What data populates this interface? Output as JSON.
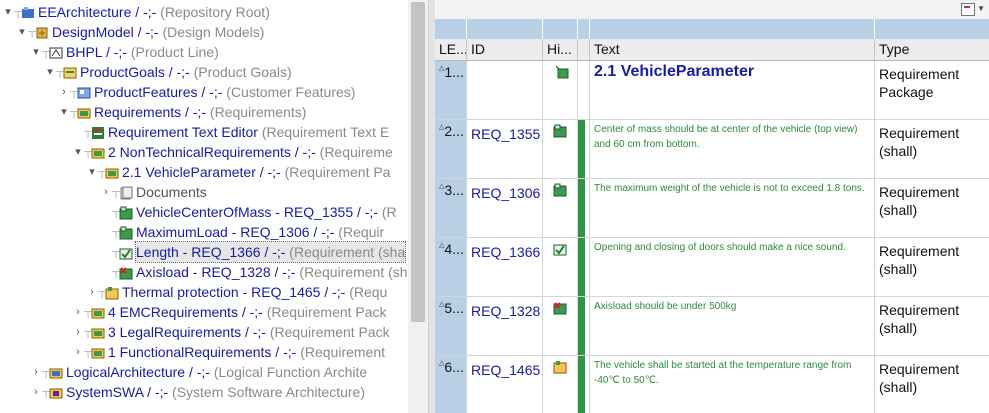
{
  "tree": {
    "rows": [
      {
        "name": "EEArchitecture / -;-",
        "meta": " (Repository Root)",
        "icon": "repository-root-icon",
        "twist": "▾"
      },
      {
        "name": "DesignModel / -;-",
        "meta": " (Design Models)",
        "icon": "design-model-icon",
        "twist": "▾"
      },
      {
        "name": "BHPL / -;-",
        "meta": " (Product Line)",
        "icon": "product-line-icon",
        "twist": "▾"
      },
      {
        "name": "ProductGoals / -;-",
        "meta": " (Product Goals)",
        "icon": "product-goals-icon",
        "twist": "▾"
      },
      {
        "name": "ProductFeatures / -;-",
        "meta": " (Customer Features)",
        "icon": "features-icon",
        "twist": "›"
      },
      {
        "name": "Requirements / -;-",
        "meta": " (Requirements)",
        "icon": "requirements-folder-icon",
        "twist": "▾"
      },
      {
        "name": "Requirement Text Editor",
        "meta": " (Requirement Text E",
        "icon": "text-editor-icon",
        "twist": ""
      },
      {
        "name": "2 NonTechnicalRequirements  / -;-",
        "meta": " (Requireme",
        "icon": "requirements-folder-icon",
        "twist": "▾"
      },
      {
        "name": "2.1 VehicleParameter  / -;-",
        "meta": " (Requirement Pa",
        "icon": "requirements-folder-icon",
        "twist": "▾"
      },
      {
        "name": "Documents",
        "meta": "",
        "icon": "documents-icon",
        "twist": "›"
      },
      {
        "name": "VehicleCenterOfMass - REQ_1355 / -;-",
        "meta": " (R",
        "icon": "requirement-green-icon",
        "twist": ""
      },
      {
        "name": "MaximumLoad - REQ_1306 / -;-",
        "meta": " (Requir",
        "icon": "requirement-green-icon",
        "twist": ""
      },
      {
        "name": "Length - REQ_1366 / -;-",
        "meta": " (Requirement (sha",
        "icon": "requirement-check-icon",
        "twist": ""
      },
      {
        "name": "Axisload - REQ_1328 / -;-",
        "meta": " (Requirement (sh",
        "icon": "requirement-warning-icon",
        "twist": ""
      },
      {
        "name": "Thermal protection - REQ_1465 / -;-",
        "meta": " (Requ",
        "icon": "requirement-yellow-icon",
        "twist": "›"
      },
      {
        "name": "4 EMCRequirements  / -;-",
        "meta": " (Requirement Pack",
        "icon": "requirements-folder-icon",
        "twist": "›"
      },
      {
        "name": "3 LegalRequirements  / -;-",
        "meta": " (Requirement Pack",
        "icon": "requirements-folder-icon",
        "twist": "›"
      },
      {
        "name": "1 FunctionalRequirements  / -;-",
        "meta": " (Requirement",
        "icon": "requirements-folder-icon",
        "twist": "›"
      },
      {
        "name": "LogicalArchitecture / -;-",
        "meta": " (Logical Function Archite",
        "icon": "logical-architecture-icon",
        "twist": "›"
      },
      {
        "name": "SystemSWA / -;-",
        "meta": " (System Software Architecture)",
        "icon": "system-swa-icon",
        "twist": "›"
      }
    ],
    "selected_index": 12
  },
  "grid": {
    "columns": [
      "LE...",
      "ID",
      "Hi...",
      "",
      "Text",
      "Type"
    ],
    "rows": [
      {
        "level": "1...",
        "id": "",
        "text": "2.1 VehicleParameter",
        "type": "Requirement Package",
        "heading": true,
        "icon": "package-hierarchy-icon"
      },
      {
        "level": "2...",
        "id": "REQ_1355",
        "text": "Center of mass should be at center of the vehicle (top view) and 60 cm from bottom.",
        "type": "Requirement (shall)",
        "heading": false,
        "icon": "requirement-green-icon"
      },
      {
        "level": "3...",
        "id": "REQ_1306",
        "text": "The maximum weight of the vehicle is not to exceed 1.8 tons.",
        "type": "Requirement (shall)",
        "heading": false,
        "icon": "requirement-green-icon"
      },
      {
        "level": "4...",
        "id": "REQ_1366",
        "text": "Opening and closing of doors should make a nice sound.",
        "type": "Requirement (shall)",
        "heading": false,
        "icon": "requirement-check-icon"
      },
      {
        "level": "5...",
        "id": "REQ_1328",
        "text": "Axisload should be under 500kg",
        "type": "Requirement (shall)",
        "heading": false,
        "icon": "requirement-warning-icon"
      },
      {
        "level": "6...",
        "id": "REQ_1465",
        "text": "The vehicle shall be started at the temperature range from -40℃ to 50℃.",
        "type": "Requirement (shall)",
        "heading": false,
        "icon": "requirement-yellow-icon"
      }
    ]
  },
  "colors": {
    "link_blue": "#1a1aa8",
    "meta_grey": "#8a8a8a",
    "band_blue": "#b8cfe6",
    "requirement_green": "#2e9447"
  }
}
